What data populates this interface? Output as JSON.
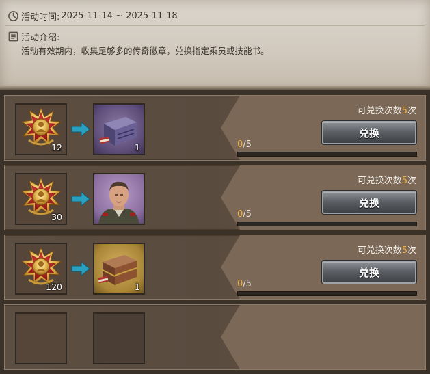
{
  "event": {
    "time_label": "活动时间:",
    "time_value": "2025-11-14 ~ 2025-11-18",
    "intro_label": "活动介绍:",
    "intro_text": "活动有效期内，收集足够多的传奇徽章，兑换指定乘员或技能书。"
  },
  "rows": [
    {
      "cost": "12",
      "reward_type": "purple-crate",
      "reward_count": "1",
      "progress_current": "0",
      "progress_total": "/5",
      "progress_fraction": 0,
      "times_label": "可兑换次数",
      "times_value": "5",
      "times_suffix": "次",
      "button_label": "兑换"
    },
    {
      "cost": "30",
      "reward_type": "officer-portrait",
      "reward_count": "",
      "progress_current": "0",
      "progress_total": "/5",
      "progress_fraction": 0,
      "times_label": "可兑换次数",
      "times_value": "5",
      "times_suffix": "次",
      "button_label": "兑换"
    },
    {
      "cost": "120",
      "reward_type": "gold-crate",
      "reward_count": "1",
      "progress_current": "0",
      "progress_total": "/5",
      "progress_fraction": 0,
      "times_label": "可兑换次数",
      "times_value": "5",
      "times_suffix": "次",
      "button_label": "兑换"
    }
  ],
  "icons": {
    "clock": "clock-icon",
    "intro": "document-icon",
    "medal": "legend-medal-icon",
    "arrow": "arrow-right-icon"
  },
  "colors": {
    "accent": "#f0b040",
    "row_bg": "#5d4e42",
    "button": "#5d6166",
    "parchment": "#d2cabf"
  }
}
